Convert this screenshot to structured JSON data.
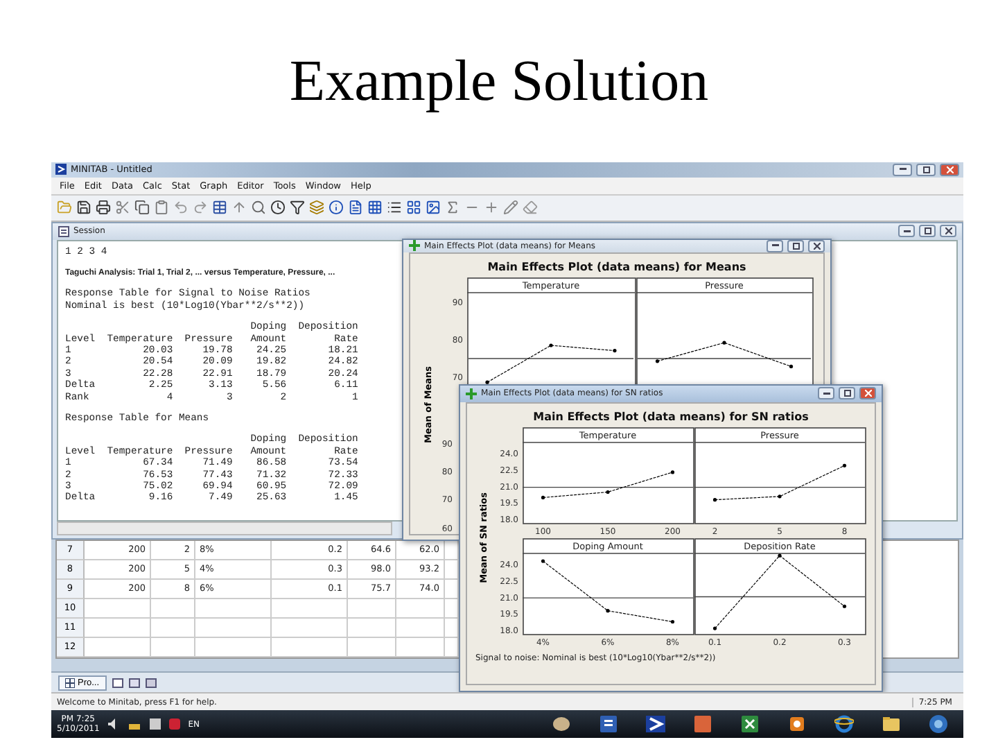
{
  "slide_title": "Example Solution",
  "window": {
    "title": "MINITAB - Untitled"
  },
  "menu": [
    "File",
    "Edit",
    "Data",
    "Calc",
    "Stat",
    "Graph",
    "Editor",
    "Tools",
    "Window",
    "Help"
  ],
  "session": {
    "title": "Session",
    "blocks": [
      {
        "lines": [
          {
            "kind": "mono",
            "text": "1 2 3 4"
          }
        ]
      },
      {
        "lines": [
          {
            "kind": "heading",
            "text": "Taguchi Analysis: Trial 1, Trial 2, ... versus Temperature, Pressure, ..."
          }
        ]
      },
      {
        "lines": [
          {
            "kind": "mono",
            "text": "Response Table for Signal to Noise Ratios"
          },
          {
            "kind": "mono",
            "text": "Nominal is best (10*Log10(Ybar**2/s**2))"
          }
        ]
      },
      {
        "lines": [
          {
            "kind": "mono",
            "text": "                               Doping  Deposition"
          },
          {
            "kind": "mono",
            "text": "Level  Temperature  Pressure   Amount        Rate"
          },
          {
            "kind": "mono",
            "text": "1            20.03     19.78    24.25       18.21"
          },
          {
            "kind": "mono",
            "text": "2            20.54     20.09    19.82       24.82"
          },
          {
            "kind": "mono",
            "text": "3            22.28     22.91    18.79       20.24"
          },
          {
            "kind": "mono",
            "text": "Delta         2.25      3.13     5.56        6.11"
          },
          {
            "kind": "mono",
            "text": "Rank             4         3        2           1"
          }
        ]
      },
      {
        "lines": [
          {
            "kind": "mono",
            "text": "Response Table for Means"
          }
        ]
      },
      {
        "lines": [
          {
            "kind": "mono",
            "text": "                               Doping  Deposition"
          },
          {
            "kind": "mono",
            "text": "Level  Temperature  Pressure   Amount        Rate"
          },
          {
            "kind": "mono",
            "text": "1            67.34     71.49    86.58       73.54"
          },
          {
            "kind": "mono",
            "text": "2            76.53     77.43    71.32       72.33"
          },
          {
            "kind": "mono",
            "text": "3            75.02     69.94    60.95       72.09"
          },
          {
            "kind": "mono",
            "text": "Delta         9.16      7.49    25.63        1.45"
          }
        ]
      }
    ]
  },
  "worksheet": {
    "rows": [
      {
        "label": "7",
        "cells": [
          "200",
          "2",
          "8%",
          "0.2",
          "64.6",
          "62.0"
        ]
      },
      {
        "label": "8",
        "cells": [
          "200",
          "5",
          "4%",
          "0.3",
          "98.0",
          "93.2"
        ]
      },
      {
        "label": "9",
        "cells": [
          "200",
          "8",
          "6%",
          "0.1",
          "75.7",
          "74.0"
        ]
      },
      {
        "label": "10",
        "cells": []
      },
      {
        "label": "11",
        "cells": []
      },
      {
        "label": "12",
        "cells": []
      }
    ]
  },
  "project_bar": {
    "label": "Pro..."
  },
  "means_window": {
    "title": "Main Effects Plot (data means) for Means",
    "active": false,
    "plot_title": "Main Effects Plot (data means) for Means",
    "ylabel": "Mean of Means",
    "lower_ticks": [
      "90",
      "80",
      "70",
      "60"
    ],
    "panels": [
      {
        "title": "Temperature",
        "yticks": [
          "90",
          "80",
          "70"
        ]
      },
      {
        "title": "Pressure"
      }
    ]
  },
  "sn_window": {
    "title": "Main Effects Plot (data means) for SN ratios",
    "active": true,
    "plot_title": "Main Effects Plot (data means) for SN ratios",
    "ylabel": "Mean of SN ratios",
    "footnote": "Signal to noise: Nominal is best (10*Log10(Ybar**2/s**2))",
    "panels": [
      {
        "chart_data": {
          "type": "line",
          "title": "Temperature",
          "categories": [
            "100",
            "150",
            "200"
          ],
          "series": [
            {
              "color": "#000000",
              "line_style": "dashed",
              "values": [
                20.0,
                20.5,
                22.3
              ]
            }
          ],
          "ylim": [
            17.7,
            25.0
          ],
          "yticks": [
            {
              "value": 18,
              "label": "18.0"
            },
            {
              "value": 19.5,
              "label": "19.5"
            },
            {
              "value": 21,
              "label": "21.0"
            },
            {
              "value": 22.5,
              "label": "22.5"
            },
            {
              "value": 24,
              "label": "24.0"
            }
          ]
        }
      },
      {
        "chart_data": {
          "type": "line",
          "title": "Pressure",
          "categories": [
            "2",
            "5",
            "8"
          ],
          "series": [
            {
              "color": "#000000",
              "line_style": "dashed",
              "values": [
                19.8,
                20.1,
                22.9
              ]
            }
          ],
          "ylim": [
            17.7,
            25.0
          ]
        }
      },
      {
        "chart_data": {
          "type": "line",
          "title": "Doping Amount",
          "categories": [
            "4%",
            "6%",
            "8%"
          ],
          "series": [
            {
              "color": "#000000",
              "line_style": "dashed",
              "values": [
                24.3,
                19.8,
                18.8
              ]
            }
          ],
          "ylim": [
            17.7,
            25.0
          ],
          "yticks": [
            {
              "value": 18,
              "label": "18.0"
            },
            {
              "value": 19.5,
              "label": "19.5"
            },
            {
              "value": 21,
              "label": "21.0"
            },
            {
              "value": 22.5,
              "label": "22.5"
            },
            {
              "value": 24,
              "label": "24.0"
            }
          ]
        }
      },
      {
        "chart_data": {
          "type": "line",
          "title": "Deposition Rate",
          "categories": [
            "0.1",
            "0.2",
            "0.3"
          ],
          "series": [
            {
              "color": "#000000",
              "line_style": "dashed",
              "values": [
                18.2,
                24.8,
                20.2
              ]
            }
          ],
          "ylim": [
            17.7,
            25.0
          ]
        }
      }
    ]
  },
  "status_bar": {
    "text": "Welcome to Minitab, press F1 for help.",
    "time": "7:25 PM"
  },
  "taskbar": {
    "clock_time": "PM 7:25",
    "clock_date": "5/10/2011",
    "language": "EN"
  }
}
